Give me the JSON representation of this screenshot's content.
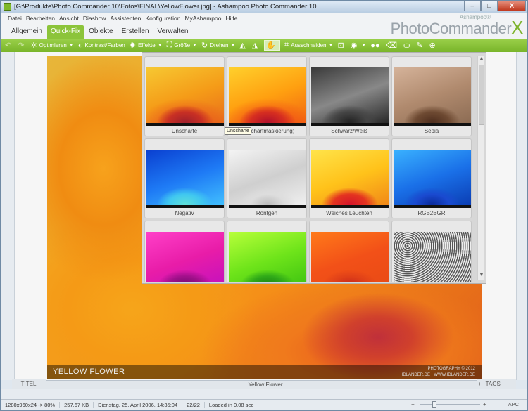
{
  "window": {
    "title": "[G:\\Produkte\\Photo Commander 10\\Fotos\\FINAL\\YellowFlower.jpg] - Ashampoo Photo Commander 10",
    "min_label": "–",
    "max_label": "□",
    "close_label": "X"
  },
  "menu": [
    "Datei",
    "Bearbeiten",
    "Ansicht",
    "Diashow",
    "Assistenten",
    "Konfiguration",
    "MyAshampoo",
    "Hilfe"
  ],
  "tabs": [
    "Allgemein",
    "Quick-Fix",
    "Objekte",
    "Erstellen",
    "Verwalten"
  ],
  "active_tab": "Quick-Fix",
  "brand": {
    "small": "Ashampoo®",
    "main": "PhotoCommander",
    "x": "X"
  },
  "toolbar": {
    "undo_icon": "undo-icon",
    "redo_icon": "redo-icon",
    "optimize": "Optimieren",
    "contrast": "Kontrast/Farben",
    "effects": "Effekte",
    "size": "Größe",
    "rotate": "Drehen",
    "crop": "Ausschneiden"
  },
  "effects": [
    {
      "label": "Unschärfe",
      "style": "orig"
    },
    {
      "label": "(Unscharfmaskierung)",
      "style": "sharp"
    },
    {
      "label": "Schwarz/Weiß",
      "style": "bw"
    },
    {
      "label": "Sepia",
      "style": "sepia"
    },
    {
      "label": "Negativ",
      "style": "neg"
    },
    {
      "label": "Röntgen",
      "style": "xray"
    },
    {
      "label": "Weiches Leuchten",
      "style": "glow"
    },
    {
      "label": "RGB2BGR",
      "style": "bgr"
    },
    {
      "label": "",
      "style": "magenta"
    },
    {
      "label": "",
      "style": "green"
    },
    {
      "label": "",
      "style": "warm"
    },
    {
      "label": "",
      "style": "dots"
    }
  ],
  "tooltip": "Unschärfe",
  "photo": {
    "title": "YELLOW FLOWER",
    "copyright1": "PHOTOGRAPHY © 2012",
    "copyright2": "IDLANDER.DE · WWW.IDLANDER.DE"
  },
  "infobar": {
    "left_label": "TITEL",
    "center": "Yellow Flower",
    "right_label": "TAGS"
  },
  "status": {
    "dimensions": "1280x960x24 -> 80%",
    "filesize": "257.67 KB",
    "date": "Dienstag, 25. April 2006, 14:35:04",
    "position": "22/22",
    "loaded": "Loaded in 0.08 sec",
    "apc": "APC"
  },
  "colors": {
    "accent": "#8cc43a",
    "toolbar": "#79b52a",
    "close": "#c0391f"
  }
}
